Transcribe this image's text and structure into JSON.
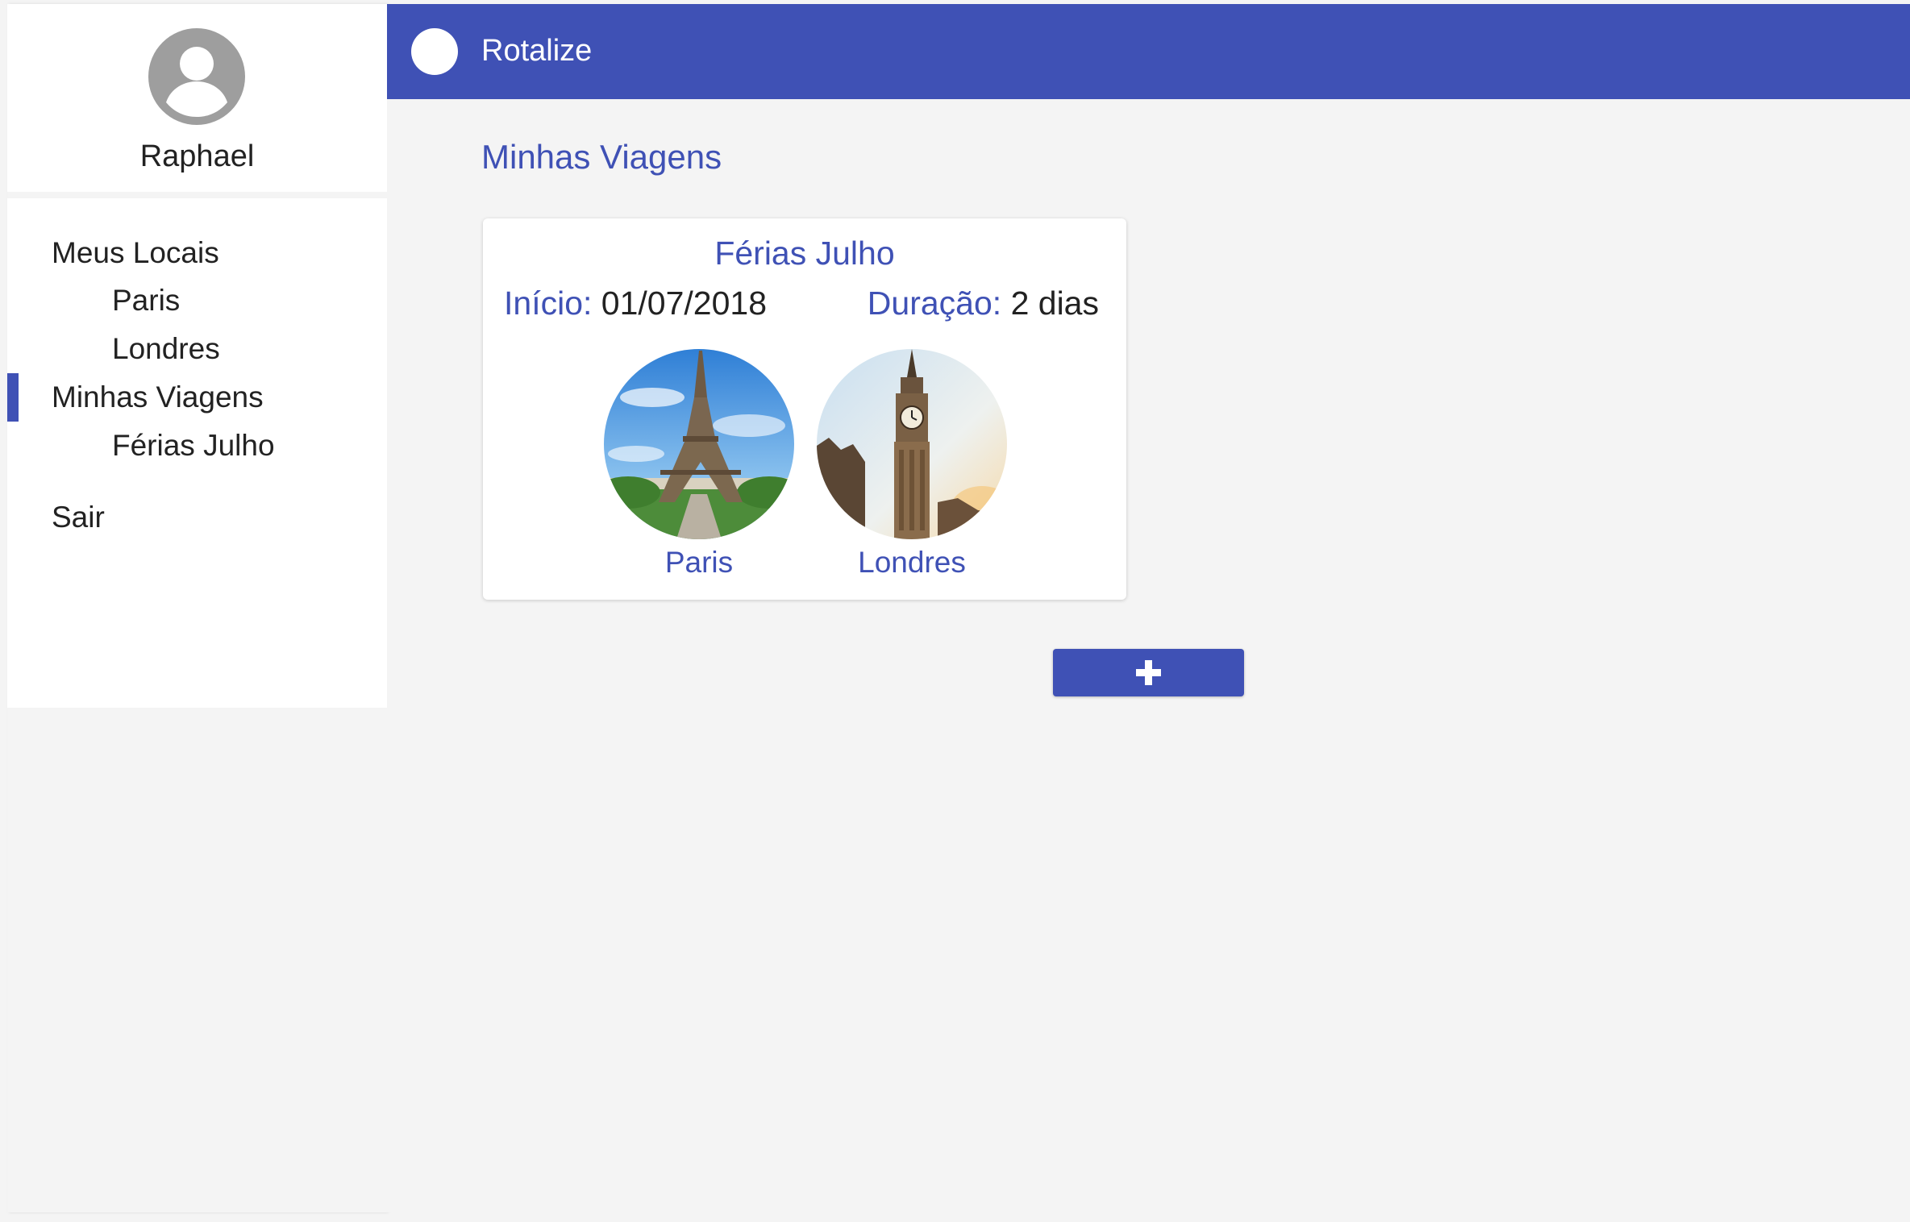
{
  "app": {
    "title": "Rotalize"
  },
  "profile": {
    "name": "Raphael",
    "avatar_icon": "account-circle-icon"
  },
  "sidebar": {
    "items": [
      {
        "label": "Meus Locais",
        "level": 0,
        "active": false
      },
      {
        "label": "Paris",
        "level": 1,
        "active": false
      },
      {
        "label": "Londres",
        "level": 1,
        "active": false
      },
      {
        "label": "Minhas Viagens",
        "level": 0,
        "active": true
      },
      {
        "label": "Férias Julho",
        "level": 1,
        "active": false
      },
      {
        "label": "Sair",
        "level": 0,
        "active": false
      }
    ]
  },
  "main": {
    "section_title": "Minhas Viagens",
    "trip": {
      "title": "Férias Julho",
      "start_label": "Início:",
      "start_value": "01/07/2018",
      "duration_label": "Duração:",
      "duration_value": "2 dias",
      "places": [
        {
          "name": "Paris",
          "image": "eiffel-tower-photo"
        },
        {
          "name": "Londres",
          "image": "big-ben-photo"
        }
      ]
    },
    "add_button_icon": "plus-icon"
  },
  "colors": {
    "primary": "#3f51b5",
    "background": "#f4f4f4",
    "surface": "#ffffff",
    "text": "#222222"
  }
}
